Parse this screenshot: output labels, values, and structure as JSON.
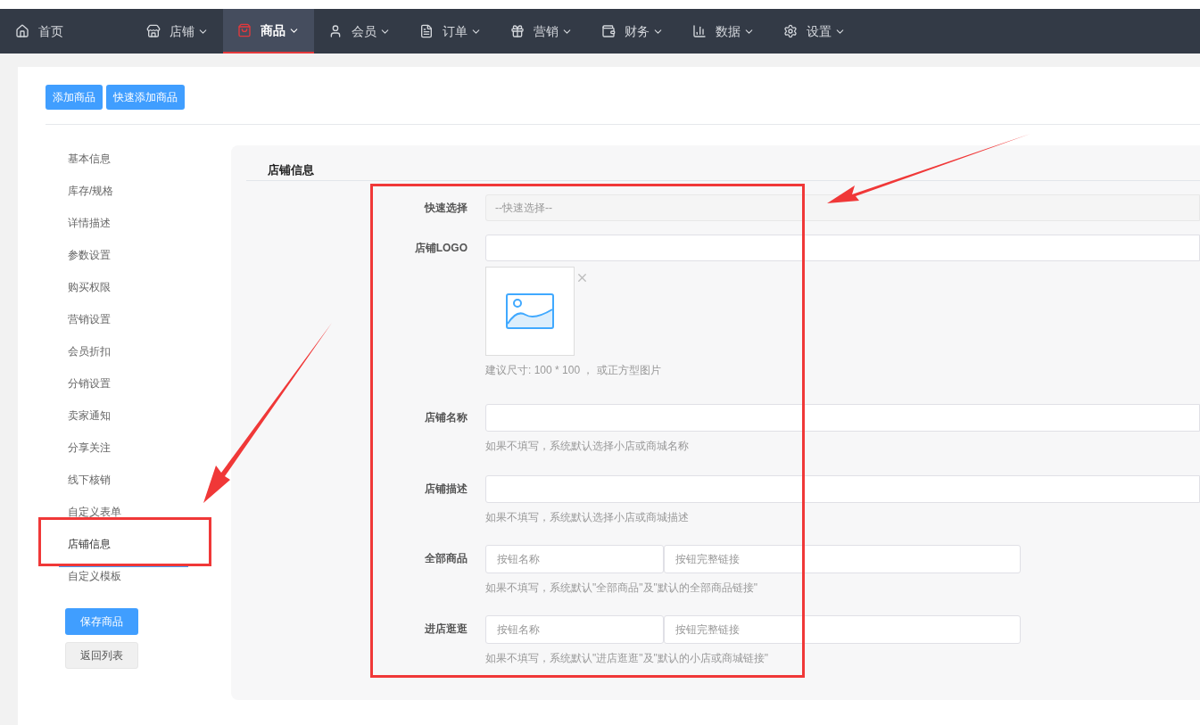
{
  "nav": {
    "items": [
      {
        "label": "首页",
        "selected": false,
        "dropdown": false
      },
      {
        "label": "店铺",
        "selected": false,
        "dropdown": true
      },
      {
        "label": "商品",
        "selected": true,
        "dropdown": true
      },
      {
        "label": "会员",
        "selected": false,
        "dropdown": true
      },
      {
        "label": "订单",
        "selected": false,
        "dropdown": true
      },
      {
        "label": "营销",
        "selected": false,
        "dropdown": true
      },
      {
        "label": "财务",
        "selected": false,
        "dropdown": true
      },
      {
        "label": "数据",
        "selected": false,
        "dropdown": true
      },
      {
        "label": "设置",
        "selected": false,
        "dropdown": true
      }
    ]
  },
  "toolbar": {
    "buttons": [
      "添加商品",
      "快速添加商品"
    ]
  },
  "sidebar": {
    "items": [
      {
        "label": "基本信息",
        "selected": false
      },
      {
        "label": "库存/规格",
        "selected": false
      },
      {
        "label": "详情描述",
        "selected": false
      },
      {
        "label": "参数设置",
        "selected": false
      },
      {
        "label": "购买权限",
        "selected": false
      },
      {
        "label": "营销设置",
        "selected": false
      },
      {
        "label": "会员折扣",
        "selected": false
      },
      {
        "label": "分销设置",
        "selected": false
      },
      {
        "label": "卖家通知",
        "selected": false
      },
      {
        "label": "分享关注",
        "selected": false
      },
      {
        "label": "线下核销",
        "selected": false
      },
      {
        "label": "自定义表单",
        "selected": false
      },
      {
        "label": "店铺信息",
        "selected": true
      },
      {
        "label": "自定义模板",
        "selected": false
      }
    ],
    "actions": [
      {
        "label": "保存商品",
        "kind": "primary"
      },
      {
        "label": "返回列表",
        "kind": "secondary"
      }
    ]
  },
  "form": {
    "title": "店铺信息",
    "fields": [
      {
        "kind": "select",
        "label": "快速选择",
        "placeholder": "--快速选择--"
      },
      {
        "kind": "image",
        "label": "店铺LOGO",
        "hint": "建议尺寸: 100 * 100 ， 或正方型图片"
      },
      {
        "kind": "text",
        "label": "店铺名称",
        "hint": "如果不填写，系统默认选择小店或商城名称"
      },
      {
        "kind": "text",
        "label": "店铺描述",
        "hint": "如果不填写，系统默认选择小店或商城描述"
      },
      {
        "kind": "pair",
        "label": "全部商品",
        "placeholders": [
          "按钮名称",
          "按钮完整链接"
        ],
        "hint": "如果不填写，系统默认\"全部商品\"及\"默认的全部商品链接\""
      },
      {
        "kind": "pair",
        "label": "进店逛逛",
        "placeholders": [
          "按钮名称",
          "按钮完整链接"
        ],
        "hint": "如果不填写，系统默认\"进店逛逛\"及\"默认的小店或商城链接\""
      }
    ]
  }
}
